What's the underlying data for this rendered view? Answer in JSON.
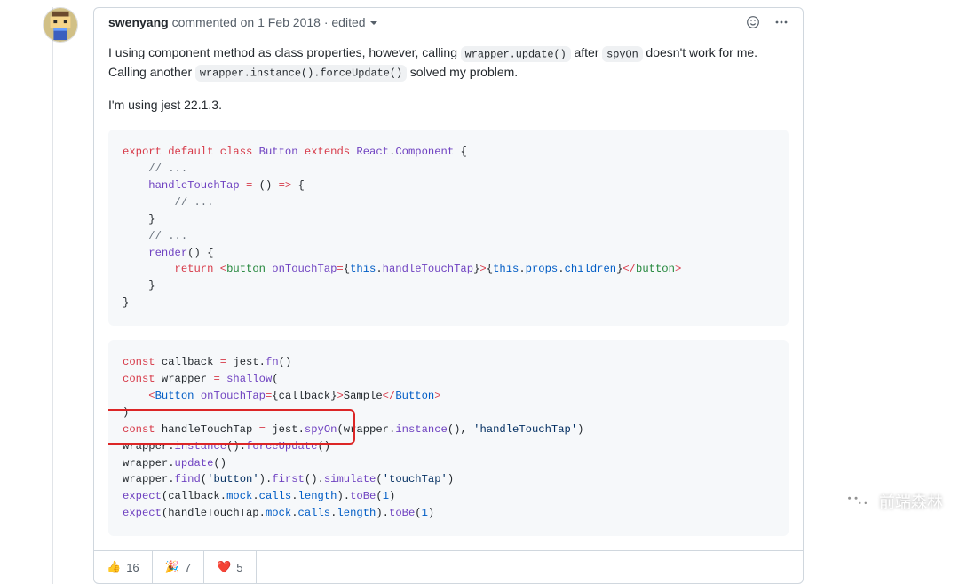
{
  "comment": {
    "author": "swenyang",
    "verb": "commented",
    "date": "on 1 Feb 2018",
    "separator": "·",
    "edited": "edited"
  },
  "body": {
    "p1_pre": "I using component method as class properties, however, calling ",
    "p1_code1": "wrapper.update()",
    "p1_mid": " after ",
    "p1_code2": "spyOn",
    "p1_tail": " doesn't work for me. Calling another ",
    "p1_code3": "wrapper.instance().forceUpdate()",
    "p1_end": " solved my problem.",
    "p2": "I'm using jest 22.1.3."
  },
  "code1": {
    "l1": {
      "a": "export",
      "b": "default",
      "c": "class",
      "d": "Button",
      "e": "extends",
      "f": "React",
      "g": ".",
      "h": "Component",
      "i": " {"
    },
    "l2": "    // ...",
    "l3": {
      "a": "    ",
      "b": "handleTouchTap",
      "c": " = ",
      "d": "()",
      "e": " => ",
      "f": "{"
    },
    "l4": "        // ...",
    "l5": "    }",
    "l6": "    // ...",
    "l7": {
      "a": "    ",
      "b": "render",
      "c": "()",
      "d": " {"
    },
    "l8": {
      "a": "        ",
      "ret": "return",
      "sp": " ",
      "lt": "<",
      "tag": "button",
      "sp2": " ",
      "attr": "onTouchTap",
      "eq": "=",
      "ob": "{",
      "this": "this",
      "dot": ".",
      "hand": "handleTouchTap",
      "cb": "}",
      "gt": ">",
      "ob2": "{",
      "this2": "this",
      "dot2": ".",
      "props": "props",
      "dot3": ".",
      "child": "children",
      "cb2": "}",
      "lt2": "</",
      "tag2": "button",
      "gt2": ">"
    },
    "l9": "    }",
    "l10": "}"
  },
  "code2": {
    "l1": {
      "const": "const",
      "sp": " ",
      "callback": "callback",
      "sp2": " ",
      "eq": "=",
      "sp3": " ",
      "jest": "jest",
      "dot": ".",
      "fn": "fn",
      "par": "()"
    },
    "l2": {
      "const": "const",
      "sp": " ",
      "wrapper": "wrapper",
      "sp2": " ",
      "eq": "=",
      "sp3": " ",
      "shallow": "shallow",
      "par": "("
    },
    "l3": {
      "ind": "    ",
      "lt": "<",
      "Button": "Button",
      "sp": " ",
      "attr": "onTouchTap",
      "eq": "=",
      "ob": "{",
      "cb": "callback",
      "cb2": "}",
      "gt": ">",
      "txt": "Sample",
      "lt2": "</",
      "Button2": "Button",
      "gt2": ">"
    },
    "l4": ")",
    "l5": {
      "const": "const",
      "sp": " ",
      "hTT": "handleTouchTap",
      "sp2": " ",
      "eq": "=",
      "sp3": " ",
      "jest": "jest",
      "dot": ".",
      "spyOn": "spyOn",
      "par": "(",
      "wrap": "wrapper",
      "dot2": ".",
      "inst": "instance",
      "par2": "()",
      "com": ", ",
      "str": "'handleTouchTap'",
      "par3": ")"
    },
    "l6": {
      "wrap": "wrapper",
      "dot": ".",
      "inst": "instance",
      "par": "()",
      "dot2": ".",
      "force": "forceUpdate",
      "par2": "()"
    },
    "l7": {
      "wrap": "wrapper",
      "dot": ".",
      "upd": "update",
      "par": "()"
    },
    "l8": {
      "wrap": "wrapper",
      "dot": ".",
      "find": "find",
      "par": "(",
      "str": "'button'",
      "par2": ")",
      "dot2": ".",
      "first": "first",
      "par3": "()",
      "dot3": ".",
      "sim": "simulate",
      "par4": "(",
      "str2": "'touchTap'",
      "par5": ")"
    },
    "l9": {
      "exp": "expect",
      "par": "(",
      "cb": "callback",
      "dot": ".",
      "mock": "mock",
      "dot2": ".",
      "calls": "calls",
      "dot3": ".",
      "length": "length",
      "par2": ")",
      "dot4": ".",
      "toBe": "toBe",
      "par3": "(",
      "one": "1",
      "par4": ")"
    },
    "l10": {
      "exp": "expect",
      "par": "(",
      "htt": "handleTouchTap",
      "dot": ".",
      "mock": "mock",
      "dot2": ".",
      "calls": "calls",
      "dot3": ".",
      "length": "length",
      "par2": ")",
      "dot4": ".",
      "toBe": "toBe",
      "par3": "(",
      "one": "1",
      "par4": ")"
    }
  },
  "reactions": [
    {
      "emoji": "👍",
      "count": "16"
    },
    {
      "emoji": "🎉",
      "count": "7"
    },
    {
      "emoji": "❤️",
      "count": "5"
    }
  ],
  "icons": {
    "smile": "smile-icon",
    "kebab": "kebab-icon",
    "caret": "caret-icon"
  },
  "watermark": "前端森林"
}
